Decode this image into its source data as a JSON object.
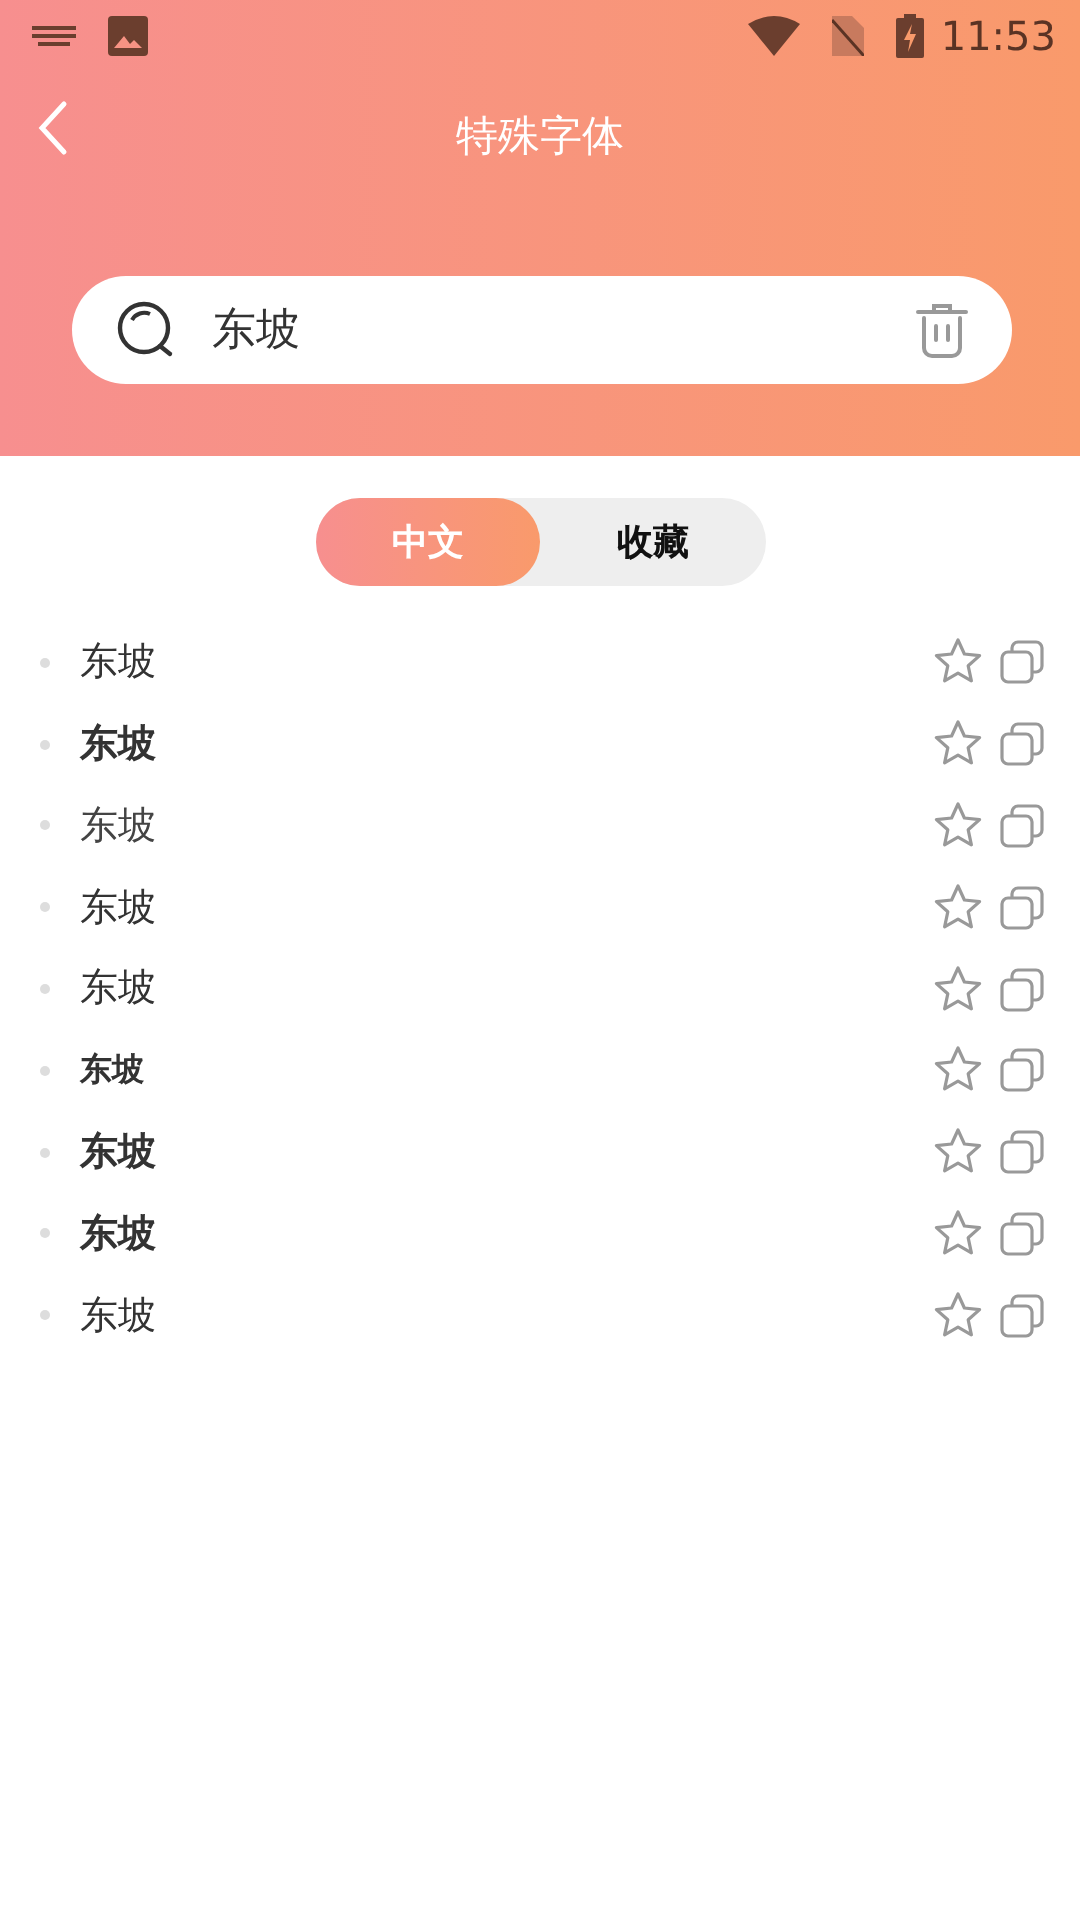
{
  "status_bar": {
    "time": "11:53"
  },
  "header": {
    "title": "特殊字体"
  },
  "search": {
    "value": "东坡"
  },
  "tabs": [
    {
      "label": "中文",
      "selected": true
    },
    {
      "label": "收藏",
      "selected": false
    }
  ],
  "fonts": [
    {
      "text": "东坡",
      "kind": "regular"
    },
    {
      "text": "东坡",
      "kind": "bold"
    },
    {
      "text": "东坡",
      "kind": "light"
    },
    {
      "text": "东坡",
      "kind": "regular"
    },
    {
      "text": "东坡",
      "kind": "regular"
    },
    {
      "text": "东坡",
      "kind": "small"
    },
    {
      "text": "东坡",
      "kind": "bold"
    },
    {
      "text": "东坡",
      "kind": "bold"
    },
    {
      "text": "东坡",
      "kind": "regular"
    }
  ]
}
